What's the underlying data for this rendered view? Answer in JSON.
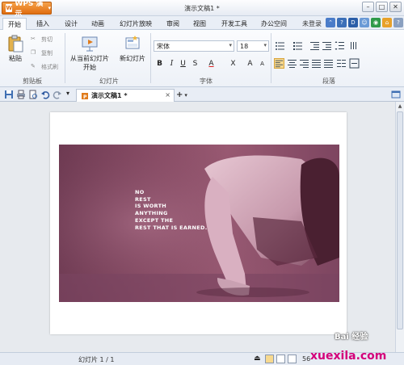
{
  "app": {
    "brand_label": "WPS 演示",
    "brand_logo": "W",
    "window_title": "演示文稿1 *"
  },
  "menu": {
    "tabs": [
      "开始",
      "插入",
      "设计",
      "动画",
      "幻灯片放映",
      "审阅",
      "视图",
      "开发工具",
      "办公空间"
    ],
    "login": "未登录"
  },
  "ribbon": {
    "clipboard": {
      "paste": "粘贴",
      "cut": "剪切",
      "copy": "复制",
      "format_painter": "格式刷",
      "group": "剪贴板"
    },
    "slides": {
      "play_current": "从当前幻灯片",
      "play_current_2": "开始",
      "new_slide": "新幻灯片",
      "group": "幻灯片"
    },
    "font": {
      "font_name": "宋体",
      "font_size": "18",
      "group": "字体",
      "bold": "B",
      "italic": "I",
      "underline": "U",
      "strike": "S",
      "color": "A",
      "superscript": "X",
      "grow": "A",
      "shrink": "A"
    },
    "paragraph": {
      "group": "段落"
    }
  },
  "quickbar": {
    "doc_tab": "演示文稿1 *",
    "doc_tab_close": "×",
    "new_tab": "+"
  },
  "slide": {
    "quote_lines": [
      "NO",
      "REST",
      "IS WORTH",
      "ANYTHING",
      "EXCEPT THE",
      "REST THAT IS EARNED."
    ]
  },
  "status": {
    "slide_counter": "幻灯片 1 / 1",
    "zoom": "56"
  },
  "watermark": {
    "site": "xuexila.com",
    "baidu": "Bai 经验"
  },
  "colors": {
    "brand": "#e06d10",
    "photo_tint": "#8a4d66",
    "watermark": "#d4007a"
  }
}
